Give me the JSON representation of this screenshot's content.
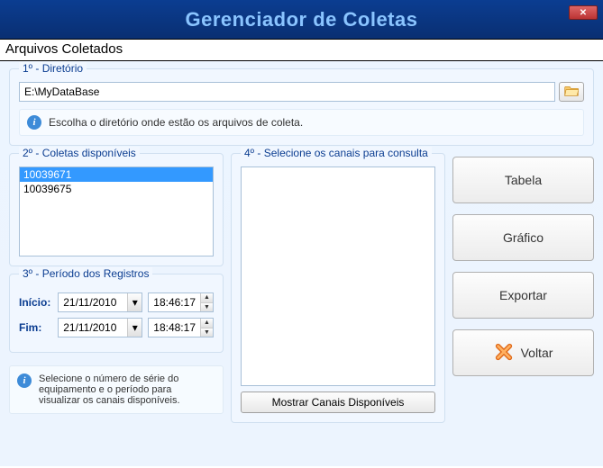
{
  "title": "Gerenciador de Coletas",
  "subheader": "Arquivos Coletados",
  "dir": {
    "group_title": "1º - Diretório",
    "path": "E:\\MyDataBase",
    "hint": "Escolha o diretório onde estão os arquivos de coleta."
  },
  "coletas": {
    "group_title": "2º - Coletas disponíveis",
    "items": [
      "10039671",
      "10039675"
    ],
    "selected_index": 0
  },
  "periodo": {
    "group_title": "3º - Período dos Registros",
    "inicio_label": "Início:",
    "fim_label": "Fim:",
    "inicio_date": "21/11/2010",
    "inicio_time": "18:46:17",
    "fim_date": "21/11/2010",
    "fim_time": "18:48:17"
  },
  "hint2": "Selecione o número de série do equipamento e o período para visualizar os canais disponíveis.",
  "canais": {
    "group_title": "4º - Selecione os canais para consulta",
    "mostrar_label": "Mostrar Canais Disponíveis"
  },
  "buttons": {
    "tabela": "Tabela",
    "grafico": "Gráfico",
    "exportar": "Exportar",
    "voltar": "Voltar"
  }
}
